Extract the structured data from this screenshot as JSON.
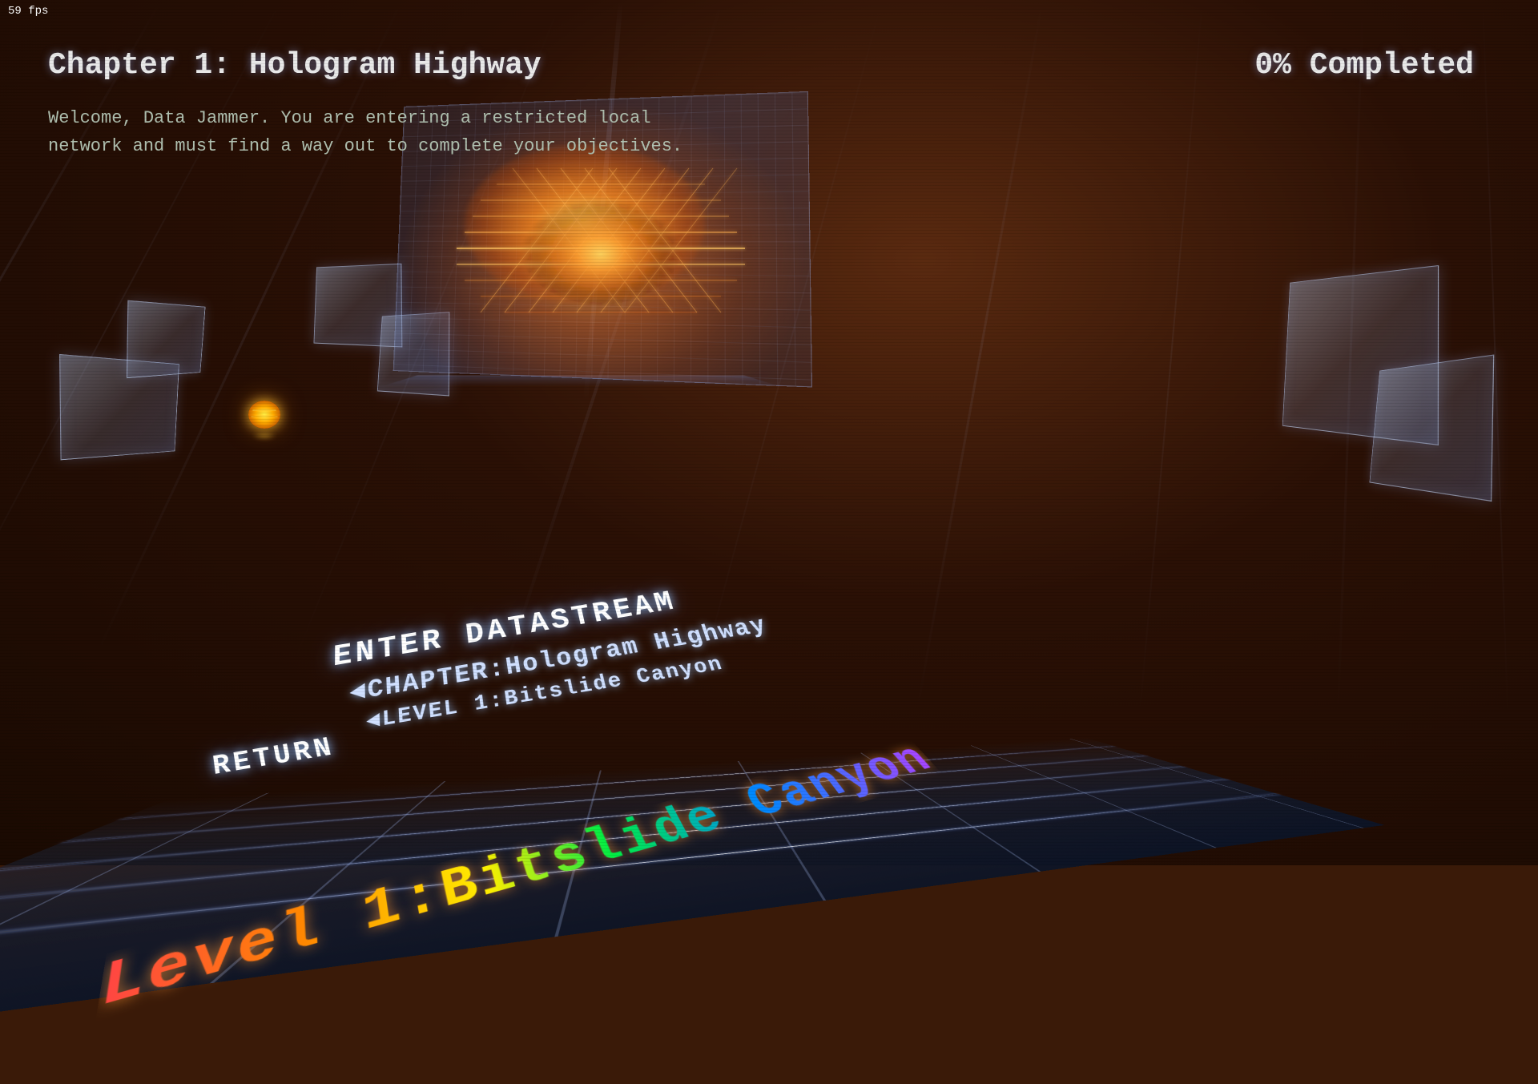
{
  "fps": "59 fps",
  "chapter": {
    "title": "Chapter 1: Hologram Highway",
    "completion": "0% Completed",
    "description_line1": "Welcome, Data Jammer.  You are entering a restricted local",
    "description_line2": "network and must find a way out to complete your objectives."
  },
  "menu": {
    "enter_datastream": "ENTER DATASTREAM",
    "chapter_label": "◄CHAPTER:Hologram Highway",
    "level_label": "◄LEVEL 1:Bitslide Canyon",
    "return_label": "RETURN",
    "play_icon": "►"
  },
  "ui": {
    "colors": {
      "background": "#3a1a08",
      "text_primary": "#e8e8e8",
      "text_secondary": "#b0c0b0",
      "accent_blue": "#8ab0ff",
      "accent_orange": "#ff9933",
      "menu_text": "#ffffff"
    }
  }
}
